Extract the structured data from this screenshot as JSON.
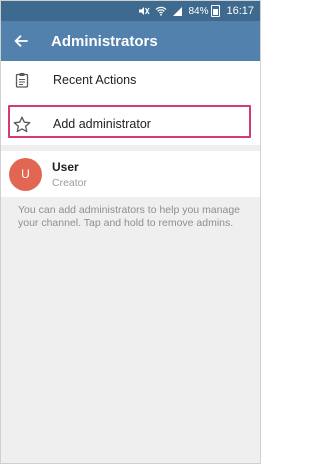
{
  "status_bar": {
    "battery": "84%",
    "time": "16:17"
  },
  "app_bar": {
    "title": "Administrators"
  },
  "menu": {
    "recent_actions": "Recent Actions",
    "add_administrator": "Add administrator"
  },
  "user": {
    "initial": "U",
    "name": "User",
    "role": "Creator"
  },
  "info": "You can add administrators to help you manage your channel. Tap and hold to remove admins.",
  "colors": {
    "app_bar": "#5281ad",
    "status_bar": "#3f6a8f",
    "avatar": "#e26753",
    "highlight": "#d23a78"
  }
}
